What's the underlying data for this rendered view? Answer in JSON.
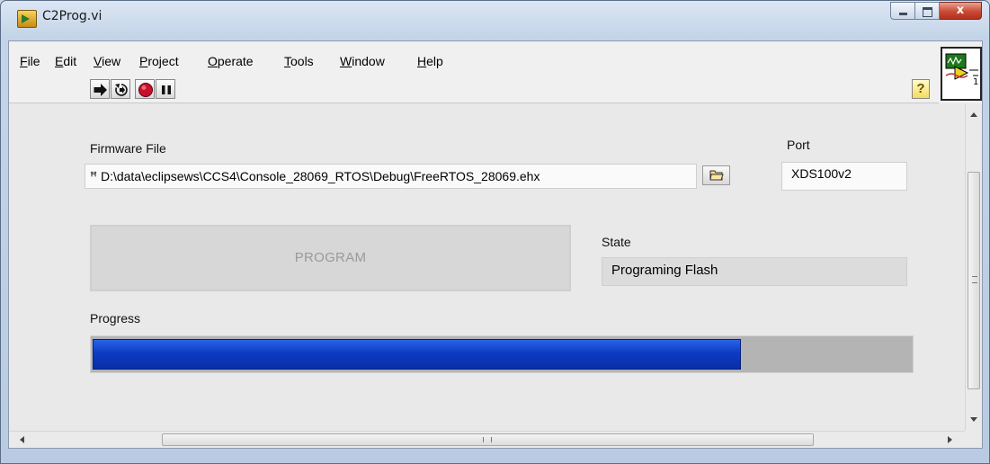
{
  "window": {
    "title": "C2Prog.vi",
    "close_glyph": "x"
  },
  "menu": [
    {
      "pre": "",
      "ul": "F",
      "post": "ile"
    },
    {
      "pre": "",
      "ul": "E",
      "post": "dit"
    },
    {
      "pre": "",
      "ul": "V",
      "post": "iew"
    },
    {
      "pre": "",
      "ul": "P",
      "post": "roject"
    },
    {
      "pre": "",
      "ul": "O",
      "post": "perate"
    },
    {
      "pre": "",
      "ul": "T",
      "post": "ools"
    },
    {
      "pre": "",
      "ul": "W",
      "post": "indow"
    },
    {
      "pre": "",
      "ul": "H",
      "post": "elp"
    }
  ],
  "toolbar": {
    "buttons": [
      "run-arrow-icon",
      "run-continuously-icon",
      "abort-icon",
      "pause-icon"
    ],
    "help_glyph": "?"
  },
  "vi_icon": {
    "counter": "1"
  },
  "firmware": {
    "label": "Firmware File",
    "path_prefix": "ꟸ",
    "path": "D:\\data\\eclipsews\\CCS4\\Console_28069_RTOS\\Debug\\FreeRTOS_28069.ehx"
  },
  "port": {
    "label": "Port",
    "value": "XDS100v2"
  },
  "program_button": {
    "label": "PROGRAM"
  },
  "state": {
    "label": "State",
    "value": "Programing Flash"
  },
  "progress": {
    "label": "Progress",
    "percent": 79.2
  },
  "colors": {
    "progress_fill": "#0d3bc4",
    "accent_close": "#c94a34"
  }
}
